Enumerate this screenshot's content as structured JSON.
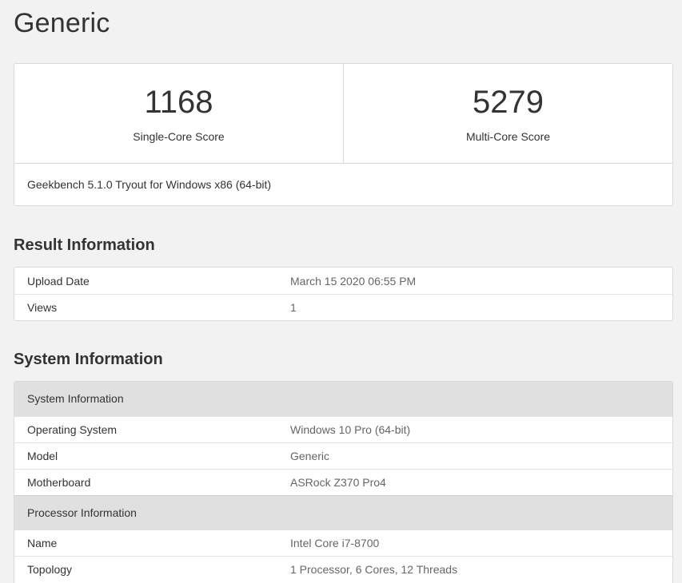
{
  "page": {
    "title": "Generic"
  },
  "scores": {
    "single_core": {
      "value": "1168",
      "label": "Single-Core Score"
    },
    "multi_core": {
      "value": "5279",
      "label": "Multi-Core Score"
    },
    "footer": "Geekbench 5.1.0 Tryout for Windows x86 (64-bit)"
  },
  "result_info": {
    "title": "Result Information",
    "rows": [
      {
        "name": "Upload Date",
        "value": "March 15 2020 06:55 PM"
      },
      {
        "name": "Views",
        "value": "1"
      }
    ]
  },
  "system_info": {
    "title": "System Information",
    "groups": [
      {
        "header": "System Information",
        "rows": [
          {
            "name": "Operating System",
            "value": "Windows 10 Pro (64-bit)"
          },
          {
            "name": "Model",
            "value": "Generic"
          },
          {
            "name": "Motherboard",
            "value": "ASRock Z370 Pro4"
          }
        ]
      },
      {
        "header": "Processor Information",
        "rows": [
          {
            "name": "Name",
            "value": "Intel Core i7-8700"
          },
          {
            "name": "Topology",
            "value": "1 Processor, 6 Cores, 12 Threads"
          }
        ]
      }
    ]
  }
}
